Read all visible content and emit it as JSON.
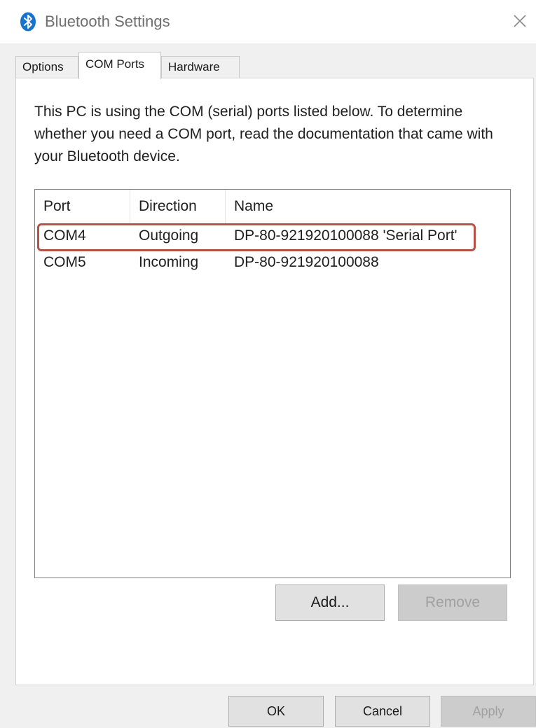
{
  "window": {
    "title": "Bluetooth Settings",
    "icon": "bluetooth-icon",
    "close_icon": "close-icon"
  },
  "tabs": [
    {
      "label": "Options",
      "selected": false
    },
    {
      "label": "COM Ports",
      "selected": true
    },
    {
      "label": "Hardware",
      "selected": false
    }
  ],
  "description": "This PC is using the COM (serial) ports listed below. To determine whether you need a COM port, read the documentation that came with your Bluetooth device.",
  "list": {
    "columns": [
      "Port",
      "Direction",
      "Name"
    ],
    "rows": [
      {
        "port": "COM4",
        "direction": "Outgoing",
        "name": "DP-80-921920100088 'Serial Port'",
        "highlighted": true
      },
      {
        "port": "COM5",
        "direction": "Incoming",
        "name": "DP-80-921920100088",
        "highlighted": false
      }
    ]
  },
  "buttons": {
    "add": "Add...",
    "remove": "Remove",
    "ok": "OK",
    "cancel": "Cancel",
    "apply": "Apply"
  },
  "colors": {
    "highlight": "#b5524a",
    "bluetooth": "#1873cc"
  }
}
